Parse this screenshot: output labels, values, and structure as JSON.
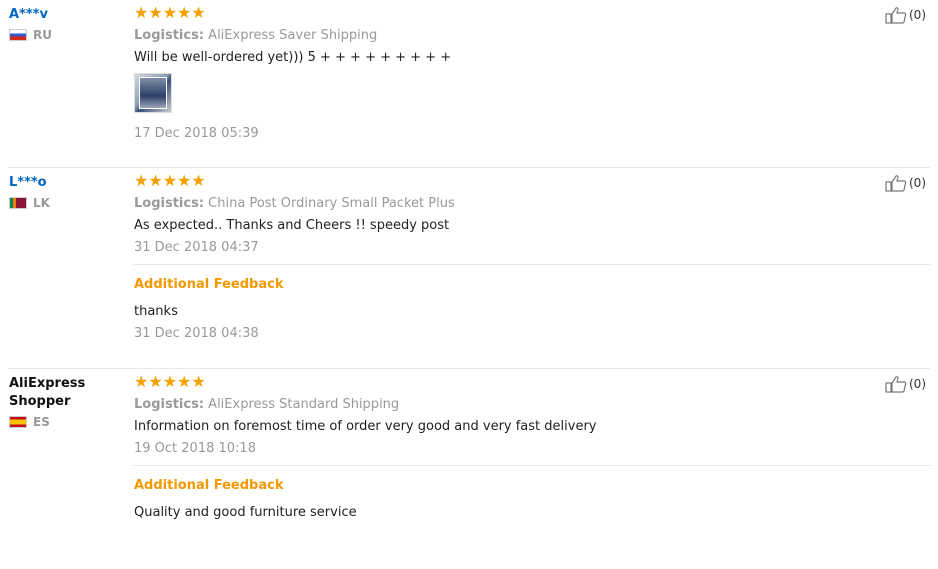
{
  "reviews": [
    {
      "user": "A***v",
      "country": "RU",
      "stars": "★★★★★",
      "logistics_label": "Logistics:",
      "logistics_value": "AliExpress Saver Shipping",
      "text": "Will be well-ordered yet))) 5 + + + + + + + + +",
      "date": "17 Dec 2018 05:39",
      "likes": "(0)"
    },
    {
      "user": "L***o",
      "country": "LK",
      "stars": "★★★★★",
      "logistics_label": "Logistics:",
      "logistics_value": "China Post Ordinary Small Packet Plus",
      "text": "As expected.. Thanks and Cheers !! speedy post",
      "date": "31 Dec 2018 04:37",
      "additional_title": "Additional Feedback",
      "additional_text": "thanks",
      "additional_date": "31 Dec 2018 04:38",
      "likes": "(0)"
    },
    {
      "user": "AliExpress Shopper",
      "country": "ES",
      "stars": "★★★★★",
      "logistics_label": "Logistics:",
      "logistics_value": "AliExpress Standard Shipping",
      "text": "Information on foremost time of order very good and very fast delivery",
      "date": "19 Oct 2018 10:18",
      "additional_title": "Additional Feedback",
      "additional_text": "Quality and good furniture service",
      "likes": "(0)"
    }
  ],
  "icons": {
    "like": "thumbs-up-icon",
    "star": "star-icon"
  },
  "colors": {
    "accent": "#f39800",
    "link": "#0066c0",
    "star": "#f5a000"
  }
}
